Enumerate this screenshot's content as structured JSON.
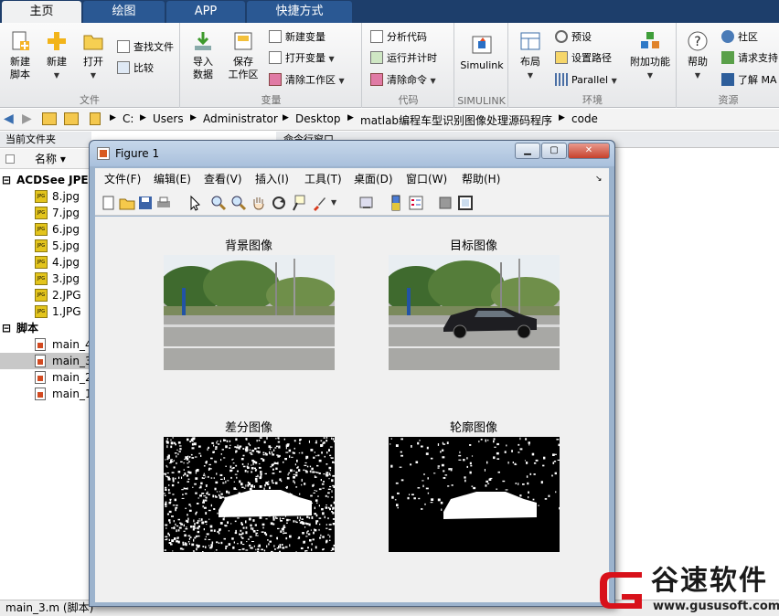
{
  "tabs": [
    "主页",
    "绘图",
    "APP",
    "快捷方式"
  ],
  "ribbon": {
    "file": {
      "label": "文件",
      "new_script": "新建\n脚本",
      "new": "新建",
      "open": "打开",
      "find_files": "查找文件",
      "compare": "比较"
    },
    "variable": {
      "label": "变量",
      "import": "导入\n数据",
      "save_ws": "保存\n工作区",
      "new_var": "新建变量",
      "open_var": "打开变量",
      "clear_ws": "清除工作区"
    },
    "code": {
      "label": "代码",
      "analyze": "分析代码",
      "run_time": "运行并计时",
      "clear_cmd": "清除命令"
    },
    "simulink": {
      "label": "SIMULINK",
      "btn": "Simulink"
    },
    "env": {
      "label": "环境",
      "layout": "布局",
      "prefs": "预设",
      "set_path": "设置路径",
      "parallel": "Parallel",
      "addons": "附加功能"
    },
    "resources": {
      "label": "资源",
      "help": "帮助",
      "community": "社区",
      "support": "请求支持",
      "learn": "了解 MA"
    }
  },
  "address": [
    "C:",
    "Users",
    "Administrator",
    "Desktop",
    "matlab编程车型识别图像处理源码程序",
    "code"
  ],
  "left_panel": {
    "title": "当前文件夹",
    "column": "名称 ▾",
    "group1": "ACDSee JPEG",
    "images": [
      "8.jpg",
      "7.jpg",
      "6.jpg",
      "5.jpg",
      "4.jpg",
      "3.jpg",
      "2.JPG",
      "1.JPG"
    ],
    "group2": "脚本",
    "scripts": [
      "main_4",
      "main_3",
      "main_2",
      "main_1"
    ],
    "selected_script": "main_3"
  },
  "cmd_title": "命令行窗口",
  "status": "main_3.m  (脚本)",
  "figure": {
    "title": "Figure 1",
    "menu": [
      "文件(F)",
      "编辑(E)",
      "查看(V)",
      "插入(I)",
      "工具(T)",
      "桌面(D)",
      "窗口(W)",
      "帮助(H)"
    ],
    "plots": [
      "背景图像",
      "目标图像",
      "差分图像",
      "轮廓图像"
    ]
  },
  "logo": {
    "name": "谷速软件",
    "url": "www.gususoft.com",
    "accent": "#d8111a"
  }
}
